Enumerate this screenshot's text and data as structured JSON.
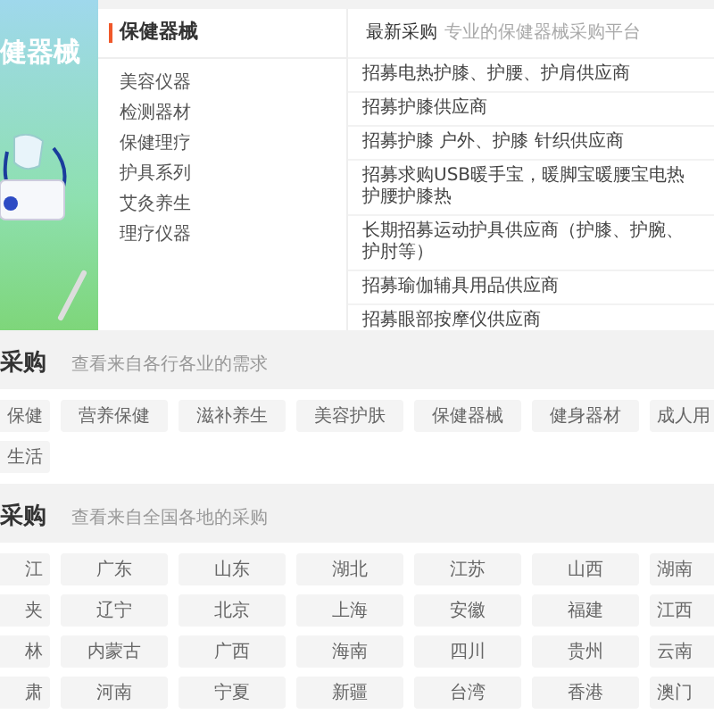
{
  "banner": {
    "title": "健器械"
  },
  "category_panel": {
    "title": "保健器械",
    "items": [
      "美容仪器",
      "检测器材",
      "保健理疗",
      "护具系列",
      "艾灸养生",
      "理疗仪器"
    ]
  },
  "latest": {
    "title": "最新采购",
    "subtitle": "专业的保健器械采购平台",
    "items": [
      "招募电热护膝、护腰、护肩供应商",
      "招募护膝供应商",
      "招募护膝 户外、护膝 针织供应商",
      "招募求购USB暖手宝，暖脚宝暖腰宝电热护腰护膝热",
      "长期招募运动护具供应商（护膝、护腕、护肘等）",
      "招募瑜伽辅具用品供应商",
      "招募眼部按摩仪供应商"
    ]
  },
  "industry_section": {
    "title": "采购",
    "subtitle": "查看来自各行各业的需求",
    "tags": [
      "保健",
      "营养保健",
      "滋补养生",
      "美容护肤",
      "保健器械",
      "健身器材",
      "成人用",
      "生活"
    ]
  },
  "region_section": {
    "title": "采购",
    "subtitle": "查看来自全国各地的采购",
    "regions": [
      "江",
      "广东",
      "山东",
      "湖北",
      "江苏",
      "山西",
      "湖南",
      "夹",
      "辽宁",
      "北京",
      "上海",
      "安徽",
      "福建",
      "江西",
      "林",
      "内蒙古",
      "广西",
      "海南",
      "四川",
      "贵州",
      "云南",
      "肃",
      "河南",
      "宁夏",
      "新疆",
      "台湾",
      "香港",
      "澳门"
    ]
  }
}
